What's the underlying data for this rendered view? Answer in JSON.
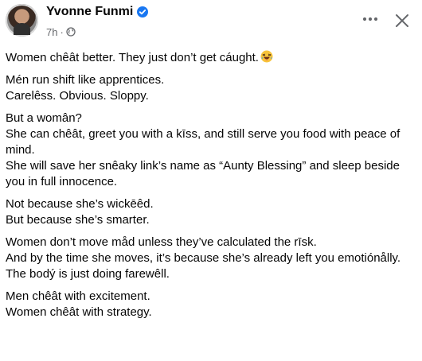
{
  "post": {
    "author": {
      "name": "Yvonne Funmi",
      "avatar_icon": "user-avatar-photo",
      "verified_icon": "verified-badge-icon",
      "verified_color": "#1877f2"
    },
    "meta": {
      "time": "7h",
      "separator": "·",
      "audience_icon": "globe-icon"
    },
    "actions": {
      "more_icon": "more-horizontal-icon",
      "close_icon": "close-icon"
    },
    "paragraphs": [
      "Women chêât better. They just don’t get cáught.",
      "Mén run shift like apprentices.\nCarelêss. Obvious. Sloppy.",
      "But a womân?\nShe can chêât, greet you with a kīss, and still serve you food with peace of mind.\nShe will save her snêaky link’s name as “Aunty Blessing” and sleep beside you in full innocence.",
      "Not because she’s wickēêd.\nBut because she’s smarter.",
      "Women don’t move måd unless they’ve calculated the rīsk.\nAnd by the time she moves, it’s because she’s already left you emotiónålly.\nThe bodý is just doing farewêll.",
      "Men chêât with excitement.\nWomen chêât with strategy."
    ],
    "emoji_icon": "laughing-emoji-icon"
  }
}
